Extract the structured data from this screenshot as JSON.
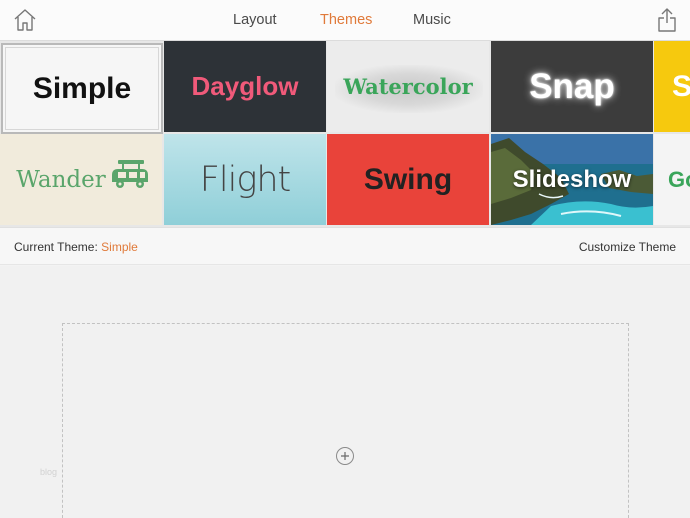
{
  "nav": {
    "tabs": [
      {
        "label": "Layout",
        "active": false
      },
      {
        "label": "Themes",
        "active": true
      },
      {
        "label": "Music",
        "active": false
      }
    ],
    "home_icon": "home-icon",
    "share_icon": "share-icon",
    "accent_color": "#e07a3a"
  },
  "themes": {
    "row1": [
      "Simple",
      "Dayglow",
      "Watercolor",
      "Snap",
      "S"
    ],
    "row2": [
      "Wander",
      "Flight",
      "Swing",
      "Slideshow",
      "Go"
    ],
    "selected": "Simple"
  },
  "theme_bar": {
    "current_label": "Current Theme:",
    "current_value": "Simple",
    "customize_label": "Customize Theme"
  },
  "canvas": {
    "add_icon": "plus-circle-icon",
    "faint_text": "blog"
  }
}
